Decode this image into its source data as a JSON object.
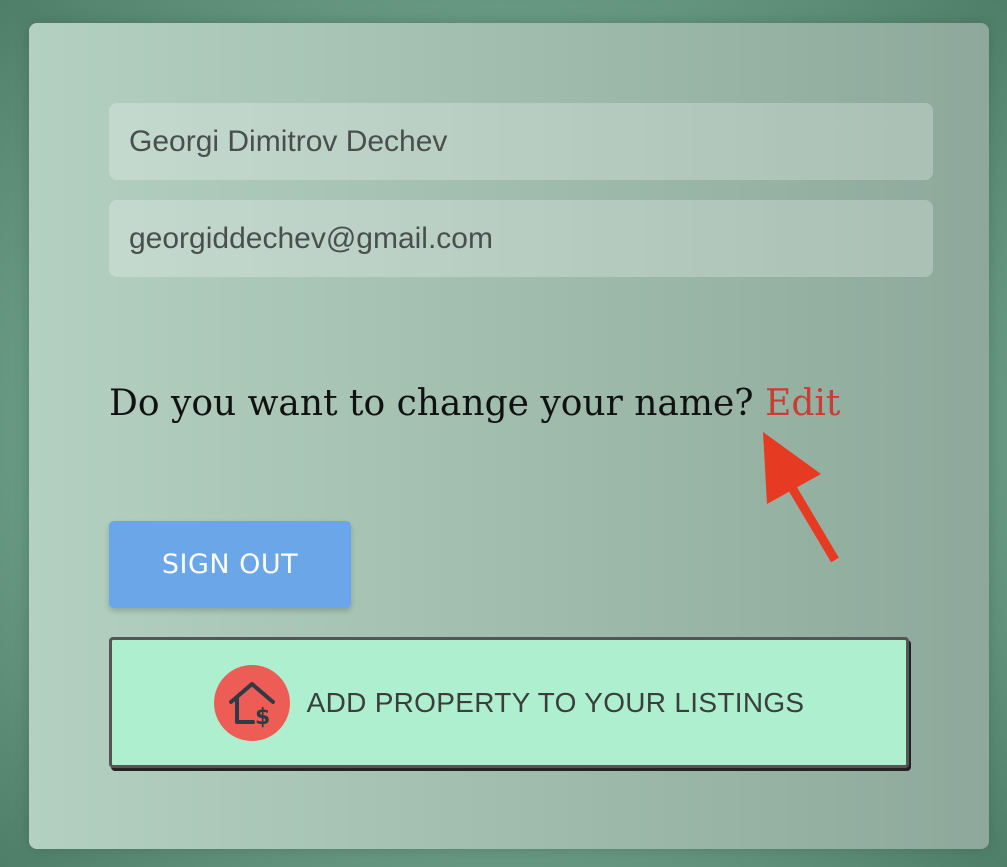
{
  "profile": {
    "name_value": "Georgi Dimitrov Dechev",
    "email_value": "georgiddechev@gmail.com"
  },
  "edit_prompt": {
    "question": "Do you want to change your name?",
    "edit_label": "Edit"
  },
  "buttons": {
    "sign_out_label": "SIGN OUT",
    "add_property_label": "ADD PROPERTY TO YOUR LISTINGS",
    "add_property_icon": "house-dollar-icon"
  },
  "annotation": {
    "arrow_icon": "red-pointer-arrow-icon"
  },
  "colors": {
    "accent_edit": "#c93d34",
    "sign_out_bg": "#6aa6e8",
    "add_property_bg": "#aeefcf",
    "icon_circle": "#ee5d55",
    "arrow": "#e63a22"
  }
}
